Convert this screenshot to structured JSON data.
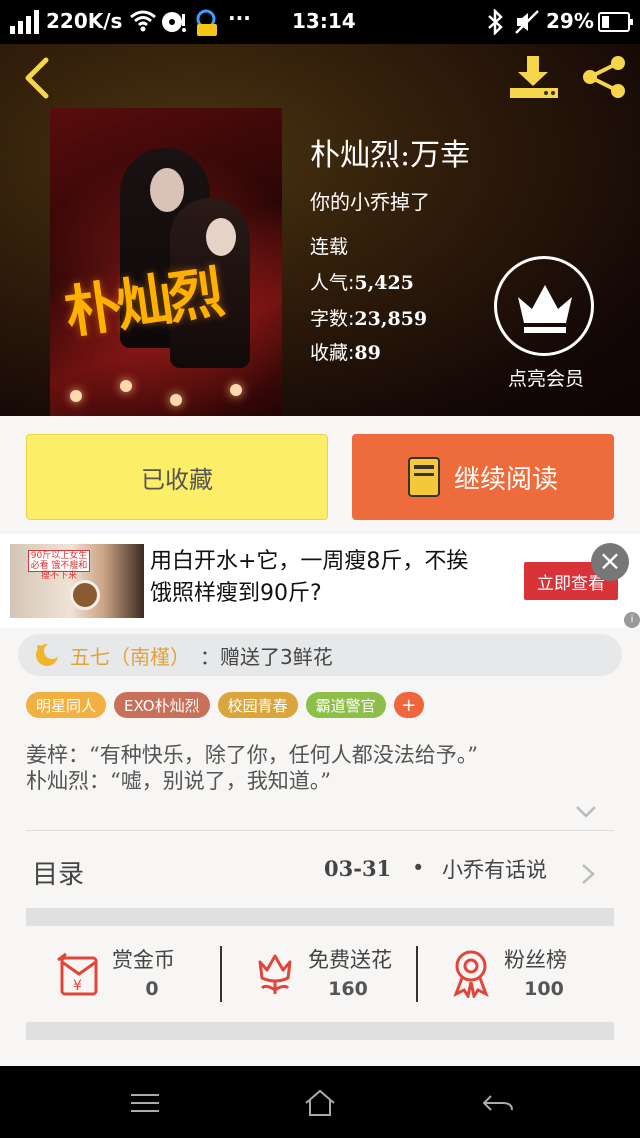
{
  "status_bar": {
    "network_speed": "220K/s",
    "dots": "···",
    "time": "13:14",
    "battery": "29%"
  },
  "book": {
    "title": "朴灿烈:万幸",
    "author": "你的小乔掉了",
    "status": "连载",
    "popularity_label": "人气:",
    "popularity": "5,425",
    "words_label": "字数:",
    "words": "23,859",
    "favorites_label": "收藏:",
    "favorites": "89",
    "cover_title": "朴灿烈"
  },
  "vip": {
    "label": "点亮会员"
  },
  "actions": {
    "favorited_label": "已收藏",
    "continue_label": "继续阅读"
  },
  "ad": {
    "text": "用白开水+它，一周瘦8斤，不挨饿照样瘦到90斤?",
    "button": "立即查看",
    "image_tag": "90斤以上女生必看 饿不瘦和瘦不下来",
    "close": "×"
  },
  "gift": {
    "user": "五七（南槿）",
    "message": "：赠送了3鲜花"
  },
  "tags": [
    {
      "label": "明星同人",
      "color": "#f2b042"
    },
    {
      "label": "EXO朴灿烈",
      "color": "#c9705a"
    },
    {
      "label": "校园青春",
      "color": "#d9a53c"
    },
    {
      "label": "霸道警官",
      "color": "#8dbe4a"
    }
  ],
  "tag_add": "+",
  "quote": {
    "line1": "姜梓：“有种快乐，除了你，任何人都没法给予。”",
    "line2": "朴灿烈：“嘘，别说了，我知道。”"
  },
  "toc": {
    "label": "目录",
    "date": "03-31",
    "dot": "•",
    "chapter": "小乔有话说"
  },
  "rewards": [
    {
      "label": "赏金币",
      "value": "0"
    },
    {
      "label": "免费送花",
      "value": "160"
    },
    {
      "label": "粉丝榜",
      "value": "100"
    }
  ],
  "colors": {
    "favorite_button": "#fdee68",
    "read_button": "#ee6b3b",
    "accent_red": "#e0463a",
    "ad_button": "#d9333a"
  }
}
